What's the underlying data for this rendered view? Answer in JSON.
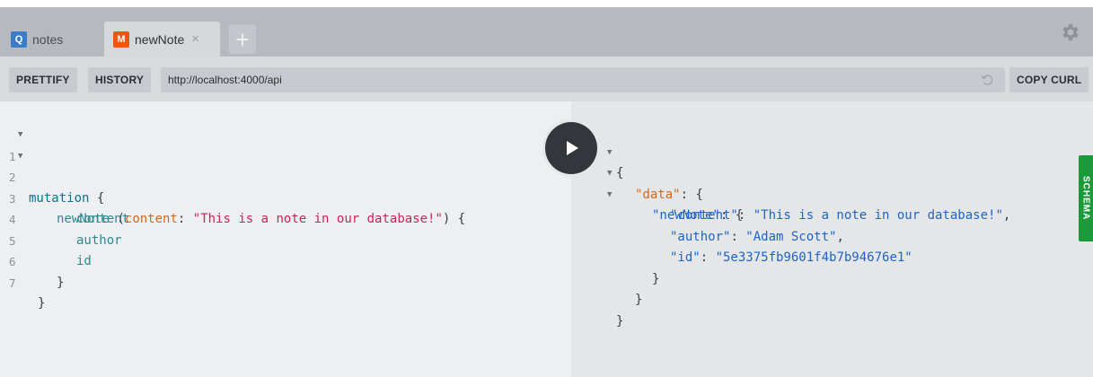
{
  "tabs": [
    {
      "badge": "Q",
      "label": "notes"
    },
    {
      "badge": "M",
      "label": "newNote",
      "close": "×"
    }
  ],
  "add_tab": "+",
  "toolbar": {
    "prettify": "PRETTIFY",
    "history": "HISTORY",
    "url": "http://localhost:4000/api",
    "copy_curl": "COPY CURL"
  },
  "icons": {
    "settings": "gear-icon",
    "reload": "reload-icon",
    "run": "play-icon"
  },
  "editor": {
    "line_numbers": [
      "1",
      "2",
      "3",
      "4",
      "5",
      "6",
      "7"
    ],
    "keyword": "mutation",
    "brace_open": "{",
    "field": "newNote",
    "arg_name": "content",
    "arg_value": "\"This is a note in our database!\"",
    "selections": [
      "content",
      "author",
      "id"
    ],
    "brace_close": "}"
  },
  "results": {
    "open": "{",
    "data_key": "\"data\"",
    "newnote_key": "\"newNote\"",
    "fields": [
      {
        "key": "\"content\"",
        "value": "\"This is a note in our database!\""
      },
      {
        "key": "\"author\"",
        "value": "\"Adam Scott\""
      },
      {
        "key": "\"id\"",
        "value": "\"5e3375fb9601f4b7b94676e1\""
      }
    ],
    "close": "}"
  },
  "schema_label": "SCHEMA",
  "colors": {
    "query_badge": "#3b7bc8",
    "mutation_badge": "#e9590c",
    "schema_tab": "#1c9a3a",
    "run_button": "#33373c"
  }
}
